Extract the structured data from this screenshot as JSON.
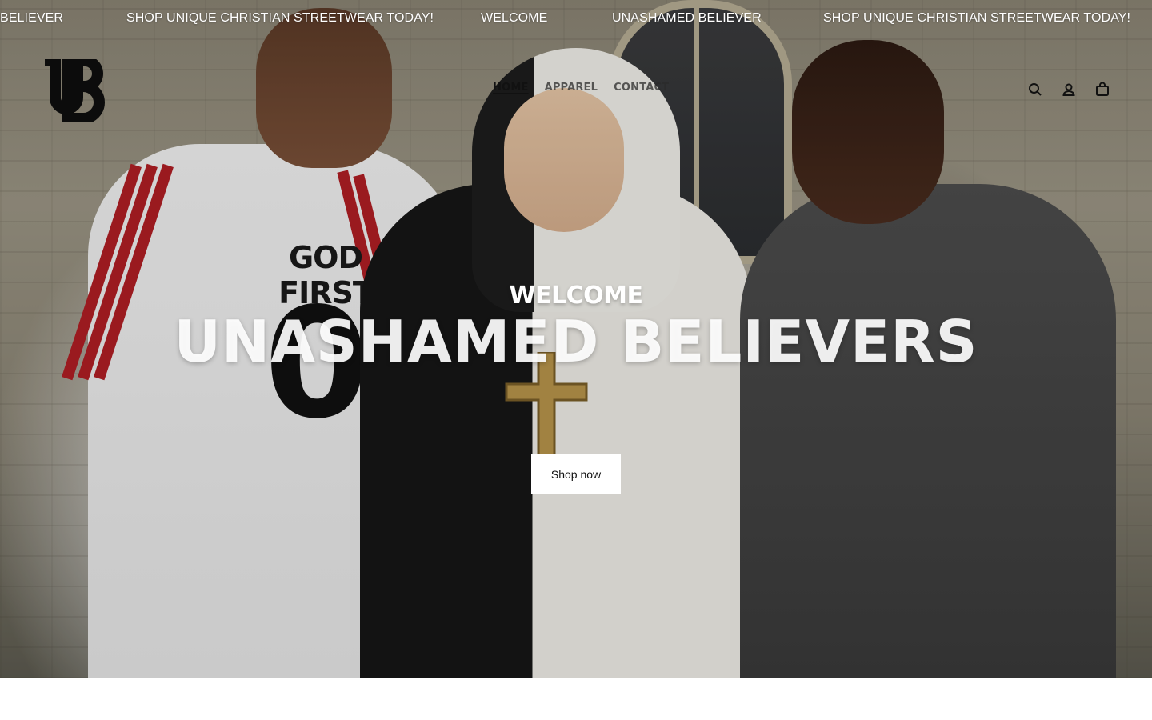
{
  "marquee": {
    "items": [
      "BELIEVER",
      "SHOP UNIQUE CHRISTIAN STREETWEAR TODAY!",
      "WELCOME",
      "UNASHAMED BELIEVER",
      "SHOP UNIQUE CHRISTIAN STREETWEAR TODAY!"
    ]
  },
  "header": {
    "logo_text": "UB",
    "nav": [
      "HOME",
      "APPAREL",
      "CONTACT"
    ],
    "active_nav": "HOME",
    "icons": [
      "search-icon",
      "account-icon",
      "cart-icon"
    ]
  },
  "hero": {
    "welcome": "WELCOME",
    "headline": "UNASHAMED BELIEVERS",
    "cta_label": "Shop now",
    "shirt_text": "GOD FIRST",
    "shirt_number": "01"
  },
  "colors": {
    "text_light": "#ffffff",
    "nav_text": "#111111",
    "button_bg": "#ffffff"
  }
}
